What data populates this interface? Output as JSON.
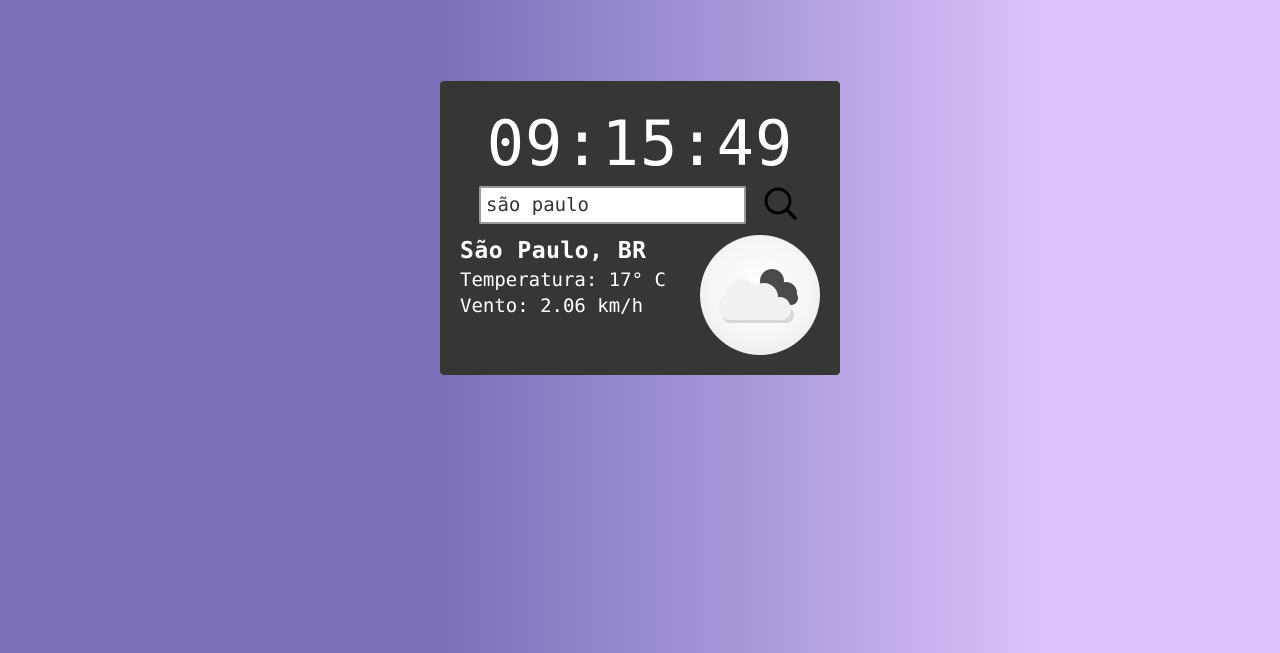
{
  "clock": {
    "time": "09:15:49"
  },
  "search": {
    "value": "são paulo",
    "placeholder": "",
    "icon": "search-icon"
  },
  "weather": {
    "city": "São Paulo, BR",
    "temperature_label": "Temperatura:",
    "temperature_value": "17° C",
    "wind_label": "Vento:",
    "wind_value": "2.06 km/h",
    "icon": "cloudy-icon"
  },
  "colors": {
    "card_background": "#363734",
    "background_gradient_start": "#7b70b8",
    "background_gradient_end": "#dcc3fb",
    "text": "#ffffff"
  }
}
